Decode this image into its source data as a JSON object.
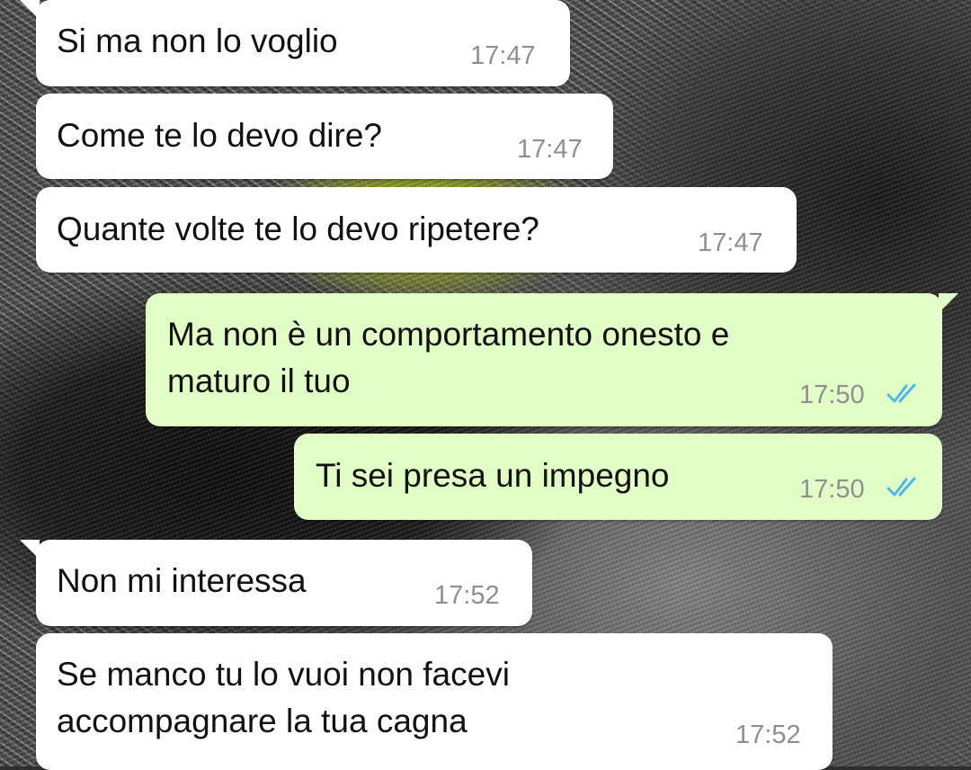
{
  "chat": {
    "messages": [
      {
        "direction": "in",
        "lines": [
          "Si ma non lo voglio"
        ],
        "time": "17:47"
      },
      {
        "direction": "in",
        "lines": [
          "Come te lo devo dire?"
        ],
        "time": "17:47"
      },
      {
        "direction": "in",
        "lines": [
          "Quante volte te lo devo ripetere?"
        ],
        "time": "17:47"
      },
      {
        "direction": "out",
        "lines": [
          "Ma non è un comportamento onesto e",
          "maturo il tuo"
        ],
        "time": "17:50",
        "status": "read"
      },
      {
        "direction": "out",
        "lines": [
          "Ti sei presa un impegno"
        ],
        "time": "17:50",
        "status": "read"
      },
      {
        "direction": "in",
        "lines": [
          "Non mi interessa"
        ],
        "time": "17:52"
      },
      {
        "direction": "in",
        "lines": [
          "Se manco tu lo vuoi non facevi",
          "accompagnare la tua cagna"
        ],
        "time": "17:52"
      }
    ]
  },
  "colors": {
    "incoming_bubble": "#ffffff",
    "outgoing_bubble": "#e1fec6",
    "timestamp": "#8f8f8f",
    "read_ticks": "#4fb6ec"
  },
  "icons": {
    "read_status": "double-check-icon"
  }
}
